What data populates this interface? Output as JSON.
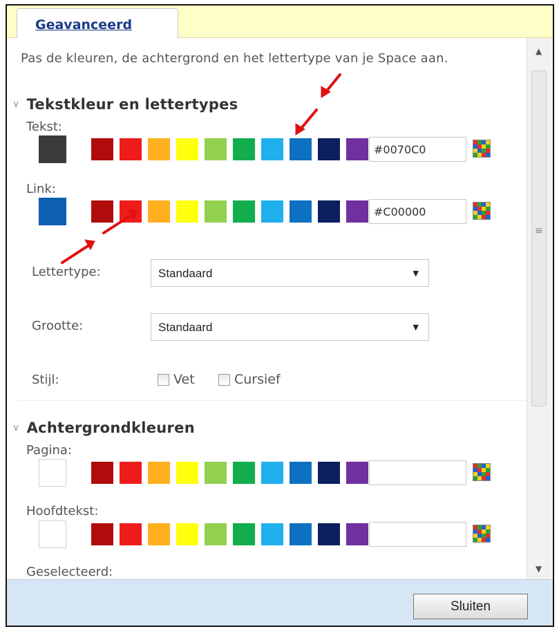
{
  "tabs": [
    {
      "label": "Geavanceerd",
      "active": true
    }
  ],
  "description": "Pas de kleuren, de achtergrond en het lettertype van je Space aan.",
  "palette": [
    "#b00c0c",
    "#f01b1b",
    "#ffb020",
    "#ffff10",
    "#92d050",
    "#12ad4c",
    "#20b0ee",
    "#0d70c0",
    "#0c1f5e",
    "#7030a0"
  ],
  "text_section": {
    "title": "Tekstkleur en lettertypes",
    "tekst": {
      "label": "Tekst:",
      "current_color": "#3b3b3b",
      "hex_value": "#0070C0"
    },
    "link": {
      "label": "Link:",
      "current_color": "#0d5fb0",
      "hex_value": "#C00000"
    },
    "font": {
      "label": "Lettertype:",
      "value": "Standaard"
    },
    "size": {
      "label": "Grootte:",
      "value": "Standaard"
    },
    "style": {
      "label": "Stijl:",
      "bold_label": "Vet",
      "bold_checked": false,
      "italic_label": "Cursief",
      "italic_checked": false
    }
  },
  "background_section": {
    "title": "Achtergrondkleuren",
    "pagina": {
      "label": "Pagina:",
      "hex_value": ""
    },
    "hoofdtekst": {
      "label": "Hoofdtekst:",
      "hex_value": ""
    },
    "geselecteerd": {
      "label": "Geselecteerd:"
    }
  },
  "footer": {
    "close_label": "Sluiten"
  },
  "colors": {
    "tab_bar": "#ffffc8",
    "footer": "#d7e6f4",
    "annotation_arrow": "#e01010"
  },
  "icons": {
    "color_picker": "color-grid-icon",
    "chevron": "chevron-down-icon"
  }
}
